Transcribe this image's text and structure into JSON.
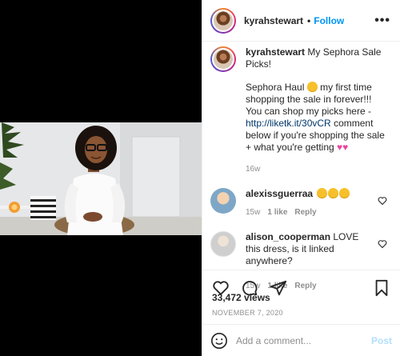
{
  "post": {
    "username": "kyrahstewart",
    "follow_label": "Follow",
    "separator": "•",
    "more_label": "•••"
  },
  "caption": {
    "username": "kyrahstewart",
    "title": "My Sephora Sale Picks!",
    "body_part1": "Sephora Haul",
    "body_part2": "my first time shopping the sale in forever!!! You can shop my picks here -",
    "link": "http://liketk.it/30vCR",
    "body_part3": "comment below if you're shopping the sale + what you're getting",
    "hearts": "💗💗",
    "time": "16w"
  },
  "comments": [
    {
      "username": "alexissguerraa",
      "text": "🤩🤩🤩",
      "time": "15w",
      "likes": "1 like",
      "reply": "Reply"
    },
    {
      "username": "alison_cooperman",
      "text": "LOVE this dress, is it linked anywhere?",
      "time": "15w",
      "likes": "1 like",
      "reply": "Reply"
    }
  ],
  "stats": {
    "views": "33,472 views",
    "date": "NOVEMBER 7, 2020"
  },
  "add_comment": {
    "placeholder": "Add a comment...",
    "post_label": "Post"
  },
  "icons": [
    "heart-icon",
    "comment-icon",
    "share-icon",
    "bookmark-icon",
    "emoji-icon",
    "more-icon"
  ],
  "colors": {
    "follow": "#0095f6",
    "link": "#00376b",
    "muted": "#8e8e8e",
    "post_disabled": "#b2dffc"
  }
}
